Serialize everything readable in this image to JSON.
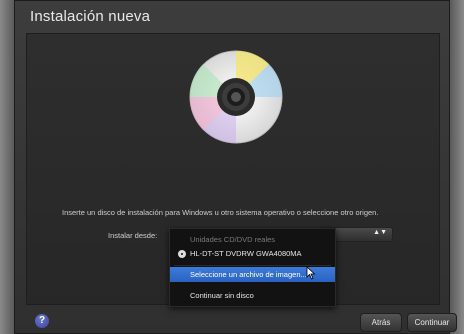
{
  "window": {
    "title": "Instalación nueva"
  },
  "main": {
    "instruction": "Inserte un disco de instalación para Windows u otro sistema operativo o seleccione otro origen.",
    "install_from_label": "Instalar desde:"
  },
  "menu": {
    "header": "Unidades CD/DVD reales",
    "device": "HL-DT-ST DVDRW GWA4080MA",
    "select_image": "Seleccione un archivo de imagen...",
    "no_disk": "Continuar sin disco"
  },
  "buttons": {
    "help": "?",
    "back": "Atrás",
    "continue": "Continuar"
  },
  "colors": {
    "selection": "#2f6fd6",
    "window_bg": "#2e2e2e"
  }
}
